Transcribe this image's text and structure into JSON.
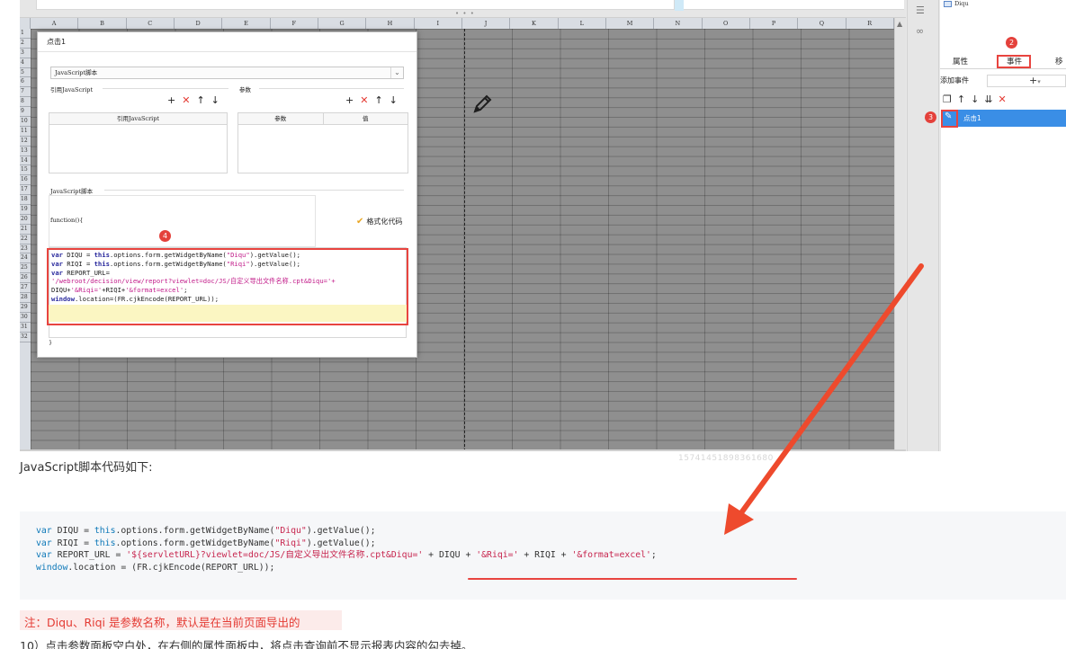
{
  "designer": {
    "columns": [
      "A",
      "B",
      "C",
      "D",
      "E",
      "F",
      "G",
      "H",
      "I",
      "J",
      "K",
      "L",
      "M",
      "N",
      "O",
      "P",
      "Q",
      "R"
    ],
    "rows": [
      "1",
      "2",
      "3",
      "4",
      "5",
      "6",
      "7",
      "8",
      "9",
      "10",
      "11",
      "12",
      "13",
      "14",
      "15",
      "16",
      "17",
      "18",
      "19",
      "20",
      "21",
      "22",
      "23",
      "24",
      "25",
      "26",
      "27",
      "28",
      "29",
      "30",
      "31",
      "32"
    ],
    "dialog": {
      "title": "点击1",
      "type_select": "JavaScript脚本",
      "ref_js_section": "引用JavaScript",
      "param_section": "参数",
      "ref_js_column": "引用JavaScript",
      "param_columns": [
        "参数",
        "值"
      ],
      "script_section": "JavaScript脚本",
      "function_open": "function(){",
      "function_close": "}",
      "format_code": "格式化代码",
      "toolbar": {
        "add": "+",
        "delete": "✕",
        "up": "↑",
        "down": "↓"
      },
      "code_lines": [
        "var DIQU = this.options.form.getWidgetByName(\"Diqu\").getValue();",
        "var RIQI = this.options.form.getWidgetByName(\"Riqi\").getValue();",
        "var REPORT_URL=",
        "'/webroot/decision/view/report?viewlet=doc/JS/自定义导出文件名称.cpt&Diqu='+",
        "DIQU+'&Riqi='+RIQI+'&format=excel';",
        "window.location=(FR.cjkEncode(REPORT_URL));"
      ]
    },
    "right_panel": {
      "top_item": "Diqu",
      "tabs": [
        "属性",
        "事件",
        "移"
      ],
      "add_event_label": "添加事件",
      "add_event_plus": "+",
      "event_item": "点击1"
    },
    "badges": [
      "2",
      "3",
      "4"
    ]
  },
  "article": {
    "caption": "JavaScript脚本代码如下:",
    "watermark": "15741451898361680",
    "code_lines": [
      "var DIQU = this.options.form.getWidgetByName(\"Diqu\").getValue();",
      "var RIQI = this.options.form.getWidgetByName(\"Riqi\").getValue();",
      "var REPORT_URL = '${servletURL}?viewlet=doc/JS/自定义导出文件名称.cpt&Diqu=' + DIQU + '&Riqi=' + RIQI + '&format=excel';",
      "window.location = (FR.cjkEncode(REPORT_URL));"
    ],
    "note": "注：Diqu、Riqi 是参数名称，默认是在当前页面导出的",
    "step10": "10）点击参数面板空白处，在右侧的属性面板中，将点击查询前不显示报表内容的勾去掉。"
  },
  "colors": {
    "accent_red": "#e8443f",
    "selection_blue": "#3a8ee6",
    "note_bg": "#fcebea"
  }
}
